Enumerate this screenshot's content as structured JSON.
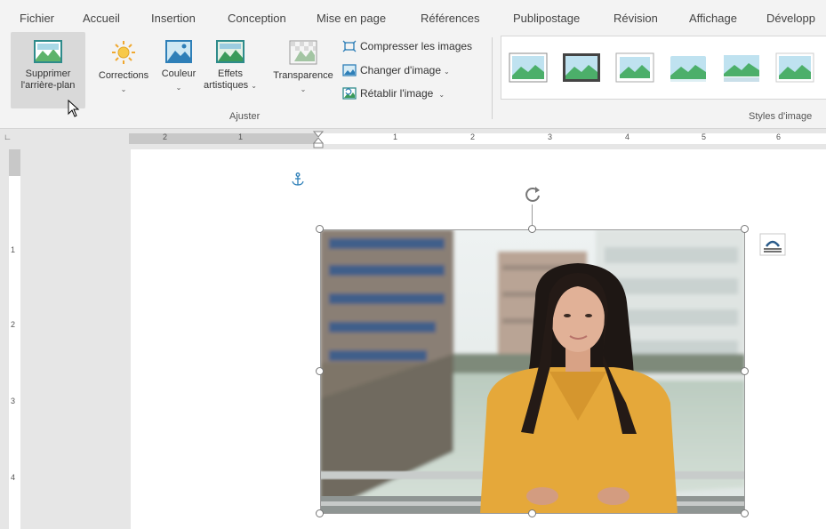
{
  "tabs": [
    "Fichier",
    "Accueil",
    "Insertion",
    "Conception",
    "Mise en page",
    "Références",
    "Publipostage",
    "Révision",
    "Affichage",
    "Développ"
  ],
  "ribbon": {
    "remove_bg_line1": "Supprimer",
    "remove_bg_line2": "l'arrière-plan",
    "corrections": "Corrections",
    "couleur": "Couleur",
    "effets_line1": "Effets",
    "effets_line2": "artistiques",
    "transparence": "Transparence",
    "compress": "Compresser les images",
    "change": "Changer d'image",
    "reset": "Rétablir l'image",
    "group_adjust": "Ajuster",
    "group_styles": "Styles d'image"
  },
  "ruler": {
    "neg": [
      "2",
      "1"
    ],
    "pos": [
      "1",
      "2",
      "3",
      "4",
      "5",
      "6"
    ],
    "vert": [
      "1",
      "2",
      "3",
      "4"
    ]
  },
  "colors": {
    "accent_teal": "#2e8b8b",
    "ribbon_bg": "#f3f3f3",
    "shirt": "#e5a83a"
  }
}
